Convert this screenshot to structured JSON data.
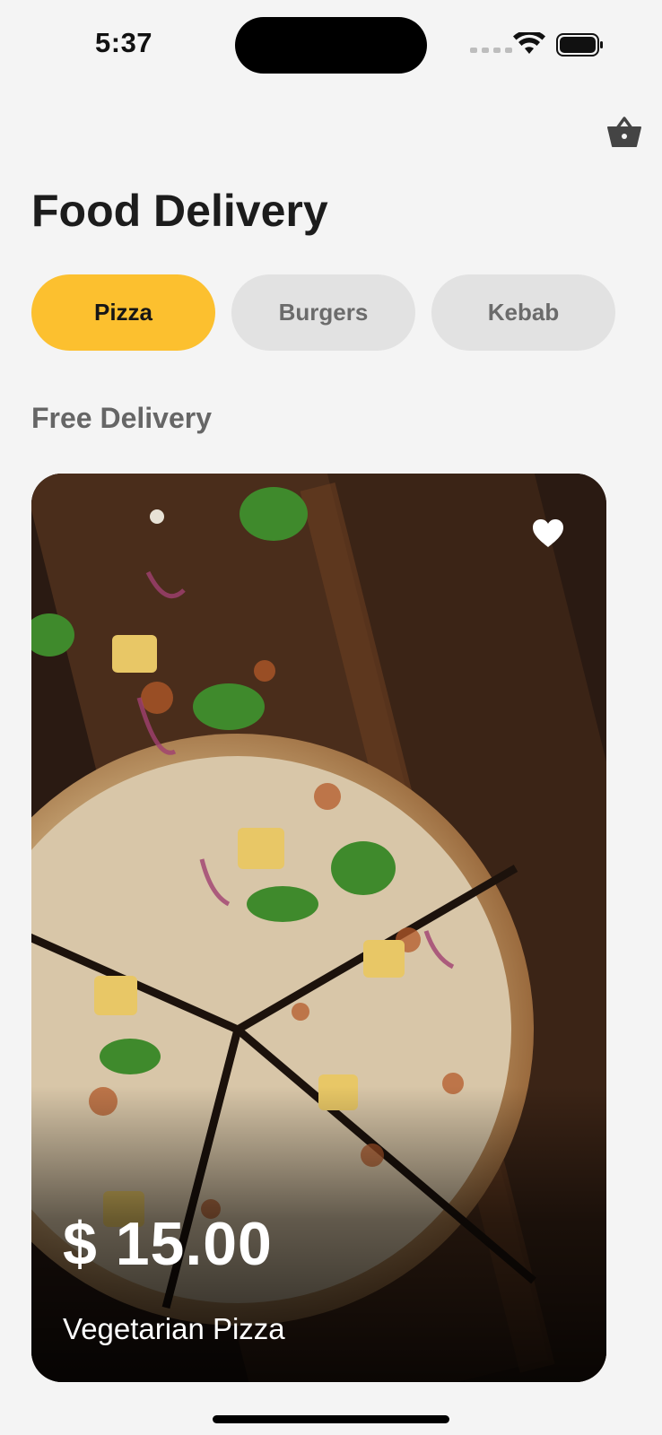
{
  "status_bar": {
    "time": "5:37"
  },
  "header": {
    "title": "Food Delivery"
  },
  "categories": [
    {
      "label": "Pizza",
      "selected": true
    },
    {
      "label": "Burgers",
      "selected": false
    },
    {
      "label": "Kebab",
      "selected": false
    }
  ],
  "section": {
    "title": "Free Delivery"
  },
  "featured_item": {
    "price": "$ 15.00",
    "name": "Vegetarian Pizza",
    "favorite": true
  },
  "icons": {
    "cart": "shopping-basket-icon",
    "favorite": "heart-icon"
  },
  "colors": {
    "accent": "#fcc02f",
    "background": "#f4f4f4",
    "tab_inactive": "#e2e2e2"
  }
}
